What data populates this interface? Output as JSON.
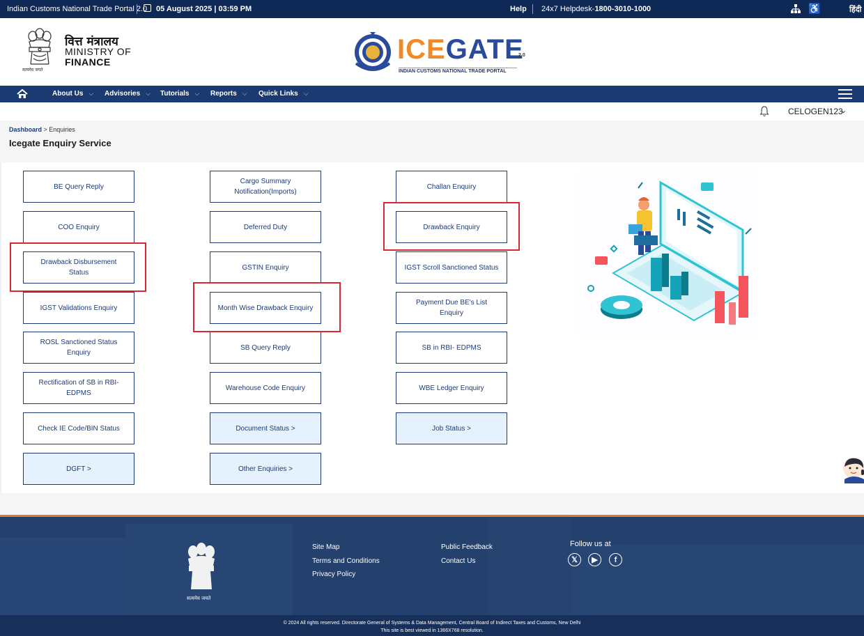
{
  "topbar": {
    "portal_name": "Indian Customs National Trade Portal 2.0",
    "datetime": "05 August 2025 | 03:59 PM",
    "help": "Help",
    "helpdesk_prefix": "24x7 Helpdesk-",
    "helpdesk_number": "1800-3010-1000",
    "language": "हिंदी",
    "icons": [
      "calendar-icon",
      "sitemap-icon",
      "accessibility-icon"
    ]
  },
  "header": {
    "emblem_caption": "सत्यमेव जयते",
    "ministry_hindi": "वित्त मंत्रालय",
    "ministry_line1": "MINISTRY OF",
    "ministry_line2": "FINANCE",
    "logo_part1": "ICE",
    "logo_part2": "GATE",
    "logo_version": "2.0",
    "logo_tagline": "INDIAN CUSTOMS NATIONAL TRADE PORTAL"
  },
  "nav": {
    "items": [
      "About Us",
      "Advisories",
      "Tutorials",
      "Reports",
      "Quick Links"
    ],
    "chevron": "⌵"
  },
  "user": {
    "name": "CELOGEN123",
    "chevron": "⌄"
  },
  "breadcrumb": {
    "home": "Dashboard",
    "separator": " > ",
    "current": "Enquiries"
  },
  "page_title": "Icegate Enquiry Service",
  "tiles": {
    "col1": [
      "BE Query Reply",
      "COO Enquiry",
      "Drawback Disbursement Status",
      "IGST Validations Enquiry",
      "ROSL Sanctioned Status Enquiry",
      "Rectification of SB in RBI-EDPMS",
      "Check IE Code/BIN Status",
      "DGFT >"
    ],
    "col2": [
      "Cargo Summary Notification(Imports)",
      "Deferred Duty",
      "GSTIN Enquiry",
      "Month Wise Drawback Enquiry",
      "SB Query Reply",
      "Warehouse Code Enquiry",
      "Document Status >",
      "Other Enquiries >"
    ],
    "col3": [
      "Challan Enquiry",
      "Drawback Enquiry",
      "IGST Scroll Sanctioned Status",
      "Payment Due BE's List Enquiry",
      "SB in RBI- EDPMS",
      "WBE Ledger Enquiry",
      "Job Status >"
    ]
  },
  "footer": {
    "emblem_caption": "सत्यमेव जयते",
    "links_col1": [
      "Site Map",
      "Terms and Conditions",
      "Privacy Policy"
    ],
    "links_col2": [
      "Public Feedback",
      "Contact Us"
    ],
    "follow": "Follow us at",
    "social": [
      "x-icon",
      "youtube-icon",
      "facebook-icon"
    ],
    "copyright": "© 2024 All rights reserved. Directorate General of Systems & Data Management, Central Board of Indirect Taxes and Customs, New Delhi",
    "resolution_note": "This site is best viewed in 1366X768 resolution."
  },
  "colors": {
    "topbar": "#0f2957",
    "navbar": "#1b3a72",
    "tile_border": "#1c3b76",
    "tile_alt_bg": "#e5f1fd",
    "highlight": "#d9282f",
    "logo_orange": "#ef8a27",
    "logo_blue": "#2a4b9b"
  }
}
